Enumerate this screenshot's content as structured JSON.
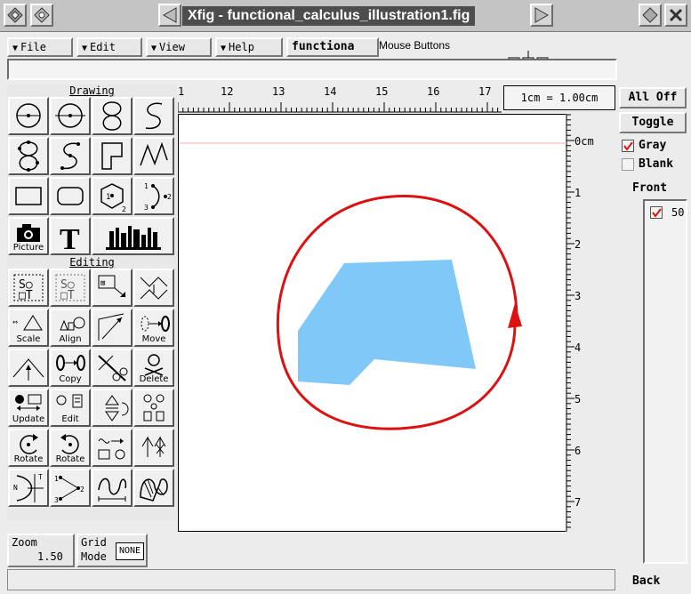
{
  "window": {
    "title": "Xfig - functional_calculus_illustration1.fig"
  },
  "menu": {
    "file": "File",
    "edit": "Edit",
    "view": "View",
    "help": "Help",
    "filename": "functiona",
    "mouse_buttons": "Mouse Buttons"
  },
  "drawing_panel": {
    "header": "Drawing",
    "picture_caption": "Picture"
  },
  "editing_panel": {
    "header": "Editing",
    "scale": "Scale",
    "align": "Align",
    "move": "Move",
    "copy": "Copy",
    "delete": "Delete",
    "update": "Update",
    "edit": "Edit",
    "rotate_ccw": "Rotate",
    "rotate_cw": "Rotate"
  },
  "ruler": {
    "scale": "1cm = 1.00cm",
    "h_ticks": [
      "1",
      "12",
      "13",
      "14",
      "15",
      "16",
      "17"
    ],
    "v_ticks": [
      "0cm",
      "1",
      "2",
      "3",
      "4",
      "5",
      "6",
      "7"
    ]
  },
  "right_panel": {
    "all_off": "All Off",
    "toggle": "Toggle",
    "gray": "Gray",
    "blank": "Blank",
    "front": "Front",
    "depth_item": "50",
    "back": "Back"
  },
  "bottom": {
    "zoom_label": "Zoom",
    "zoom_value": "1.50",
    "grid_label1": "Grid",
    "grid_label2": "Mode",
    "grid_value": "NONE"
  },
  "colors": {
    "curve": "#dd1111",
    "polygon": "#80c8f8",
    "title_bg": "#4d4d4d"
  },
  "figure": {
    "curve_shape": "closed-loop-with-arrow",
    "polygon_shape": "filled-light-blue-polygon"
  }
}
